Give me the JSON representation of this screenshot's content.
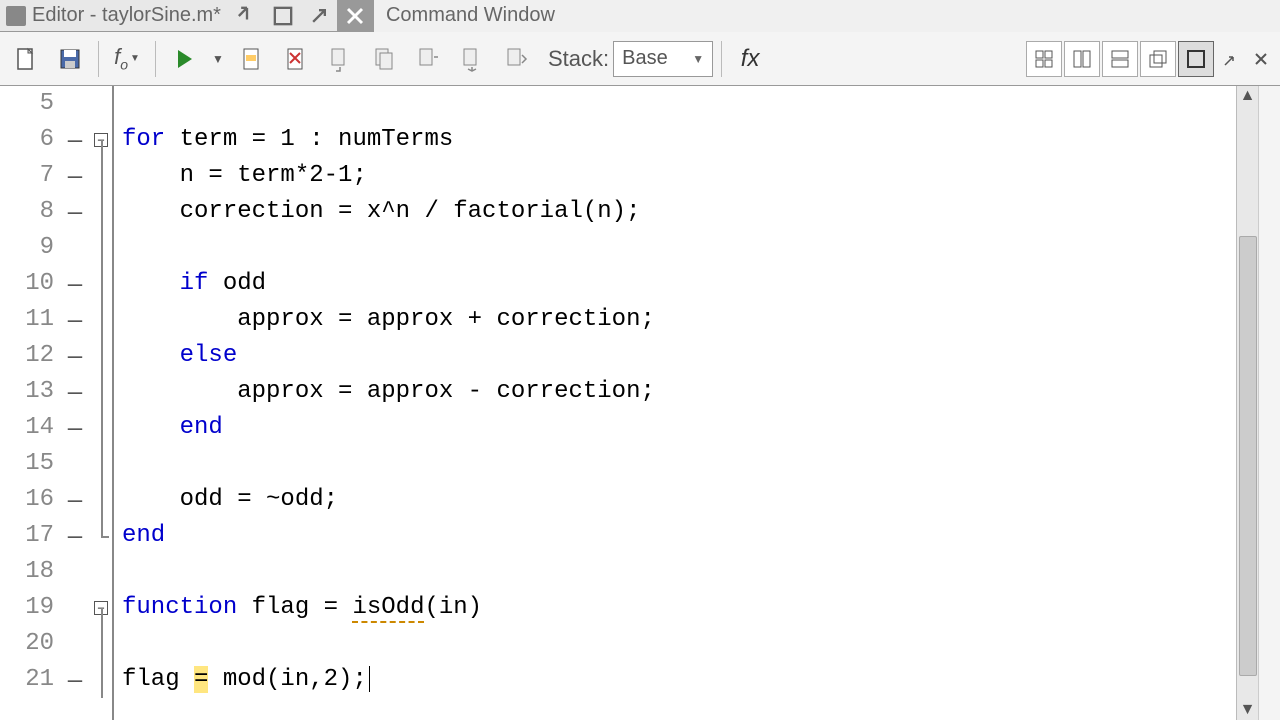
{
  "titlebar": {
    "editor_title": "Editor - taylorSine.m*",
    "cmd_title": "Command Window"
  },
  "toolbar": {
    "stack_label": "Stack:",
    "stack_value": "Base"
  },
  "gutter_start": 5,
  "lines": [
    {
      "num": 5,
      "mark": "",
      "fold": "",
      "tokens": []
    },
    {
      "num": 6,
      "mark": "—",
      "fold": "boxtop",
      "tokens": [
        {
          "t": "for ",
          "c": "kw"
        },
        {
          "t": "term = 1 : numTerms",
          "c": "fn"
        }
      ]
    },
    {
      "num": 7,
      "mark": "—",
      "fold": "line",
      "tokens": [
        {
          "t": "    n = term*2-1;",
          "c": "fn"
        }
      ]
    },
    {
      "num": 8,
      "mark": "—",
      "fold": "line",
      "tokens": [
        {
          "t": "    correction = x^n / factorial(n);",
          "c": "fn"
        }
      ]
    },
    {
      "num": 9,
      "mark": "",
      "fold": "line",
      "tokens": []
    },
    {
      "num": 10,
      "mark": "—",
      "fold": "line",
      "tokens": [
        {
          "t": "    ",
          "c": "fn"
        },
        {
          "t": "if ",
          "c": "kw"
        },
        {
          "t": "odd",
          "c": "fn"
        }
      ]
    },
    {
      "num": 11,
      "mark": "—",
      "fold": "line",
      "tokens": [
        {
          "t": "        approx = approx + correction;",
          "c": "fn"
        }
      ]
    },
    {
      "num": 12,
      "mark": "—",
      "fold": "line",
      "tokens": [
        {
          "t": "    ",
          "c": "fn"
        },
        {
          "t": "else",
          "c": "kw"
        }
      ]
    },
    {
      "num": 13,
      "mark": "—",
      "fold": "line",
      "tokens": [
        {
          "t": "        approx = approx - correction;",
          "c": "fn"
        }
      ]
    },
    {
      "num": 14,
      "mark": "—",
      "fold": "line",
      "tokens": [
        {
          "t": "    ",
          "c": "fn"
        },
        {
          "t": "end",
          "c": "kw"
        }
      ]
    },
    {
      "num": 15,
      "mark": "",
      "fold": "line",
      "tokens": []
    },
    {
      "num": 16,
      "mark": "—",
      "fold": "line",
      "tokens": [
        {
          "t": "    odd = ~odd;",
          "c": "fn"
        }
      ]
    },
    {
      "num": 17,
      "mark": "—",
      "fold": "end",
      "tokens": [
        {
          "t": "end",
          "c": "kw"
        }
      ]
    },
    {
      "num": 18,
      "mark": "",
      "fold": "",
      "tokens": []
    },
    {
      "num": 19,
      "mark": "",
      "fold": "boxtop",
      "tokens": [
        {
          "t": "function ",
          "c": "kw"
        },
        {
          "t": "flag = ",
          "c": "fn"
        },
        {
          "t": "isOdd",
          "c": "fn ul"
        },
        {
          "t": "(in)",
          "c": "fn"
        }
      ]
    },
    {
      "num": 20,
      "mark": "",
      "fold": "line",
      "tokens": []
    },
    {
      "num": 21,
      "mark": "—",
      "fold": "line",
      "tokens": [
        {
          "t": "flag ",
          "c": "fn"
        },
        {
          "t": "=",
          "c": "fn hl"
        },
        {
          "t": " mod(in,2);",
          "c": "fn"
        }
      ],
      "cursor": true
    }
  ]
}
